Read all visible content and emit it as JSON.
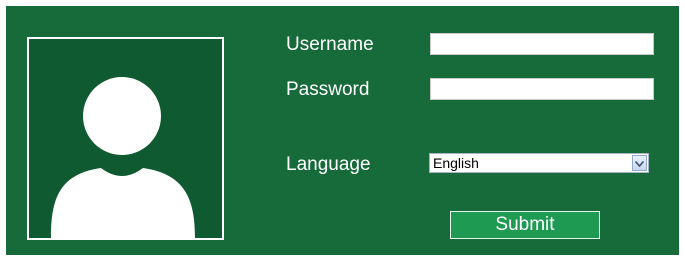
{
  "login": {
    "avatar_icon": "user-silhouette-icon",
    "username": {
      "label": "Username",
      "value": ""
    },
    "password": {
      "label": "Password",
      "value": ""
    },
    "language": {
      "label": "Language",
      "selected": "English",
      "icon": "chevron-down-icon"
    },
    "submit_label": "Submit"
  },
  "colors": {
    "panel_background": "#176b3a",
    "avatar_background": "#0f5a30",
    "submit_background": "#1f9a52",
    "text": "#ffffff"
  }
}
